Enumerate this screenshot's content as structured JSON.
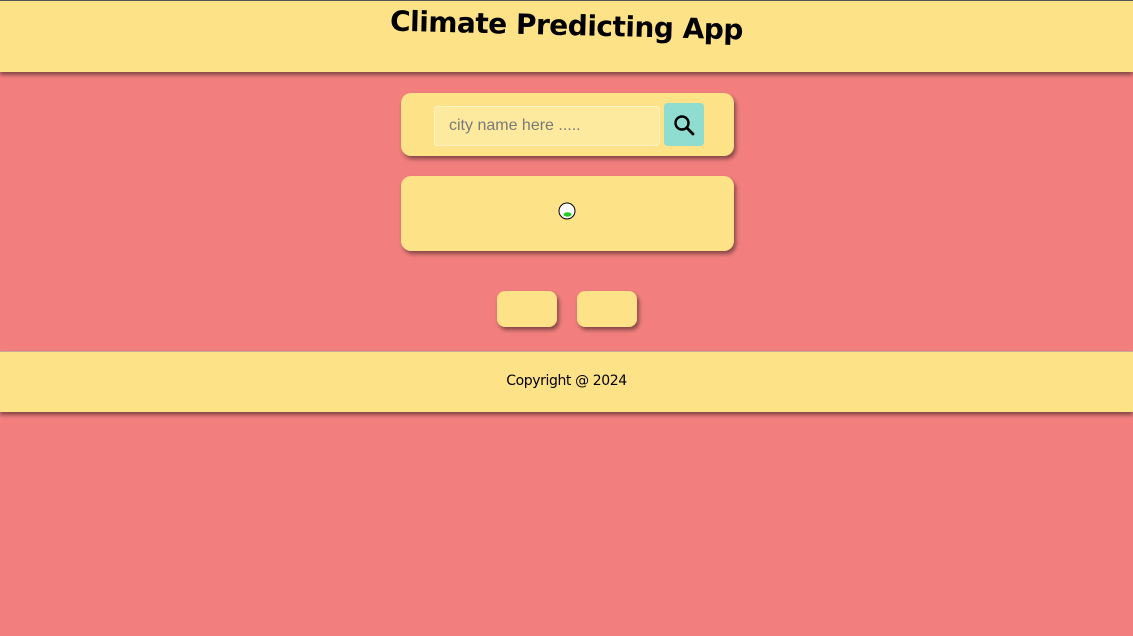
{
  "header": {
    "title": "Climate Predicting App"
  },
  "search": {
    "placeholder": "city name here .....",
    "value": "",
    "button_icon": "search-icon"
  },
  "weather": {
    "icon": "weather-status-icon"
  },
  "nav_buttons": {
    "prev_label": "",
    "next_label": ""
  },
  "footer": {
    "copyright": "Copyright @ 2024"
  },
  "colors": {
    "background": "#f27f7e",
    "panel": "#fde288",
    "search_button": "#8fdcd0",
    "input_background": "#fdea9e"
  }
}
